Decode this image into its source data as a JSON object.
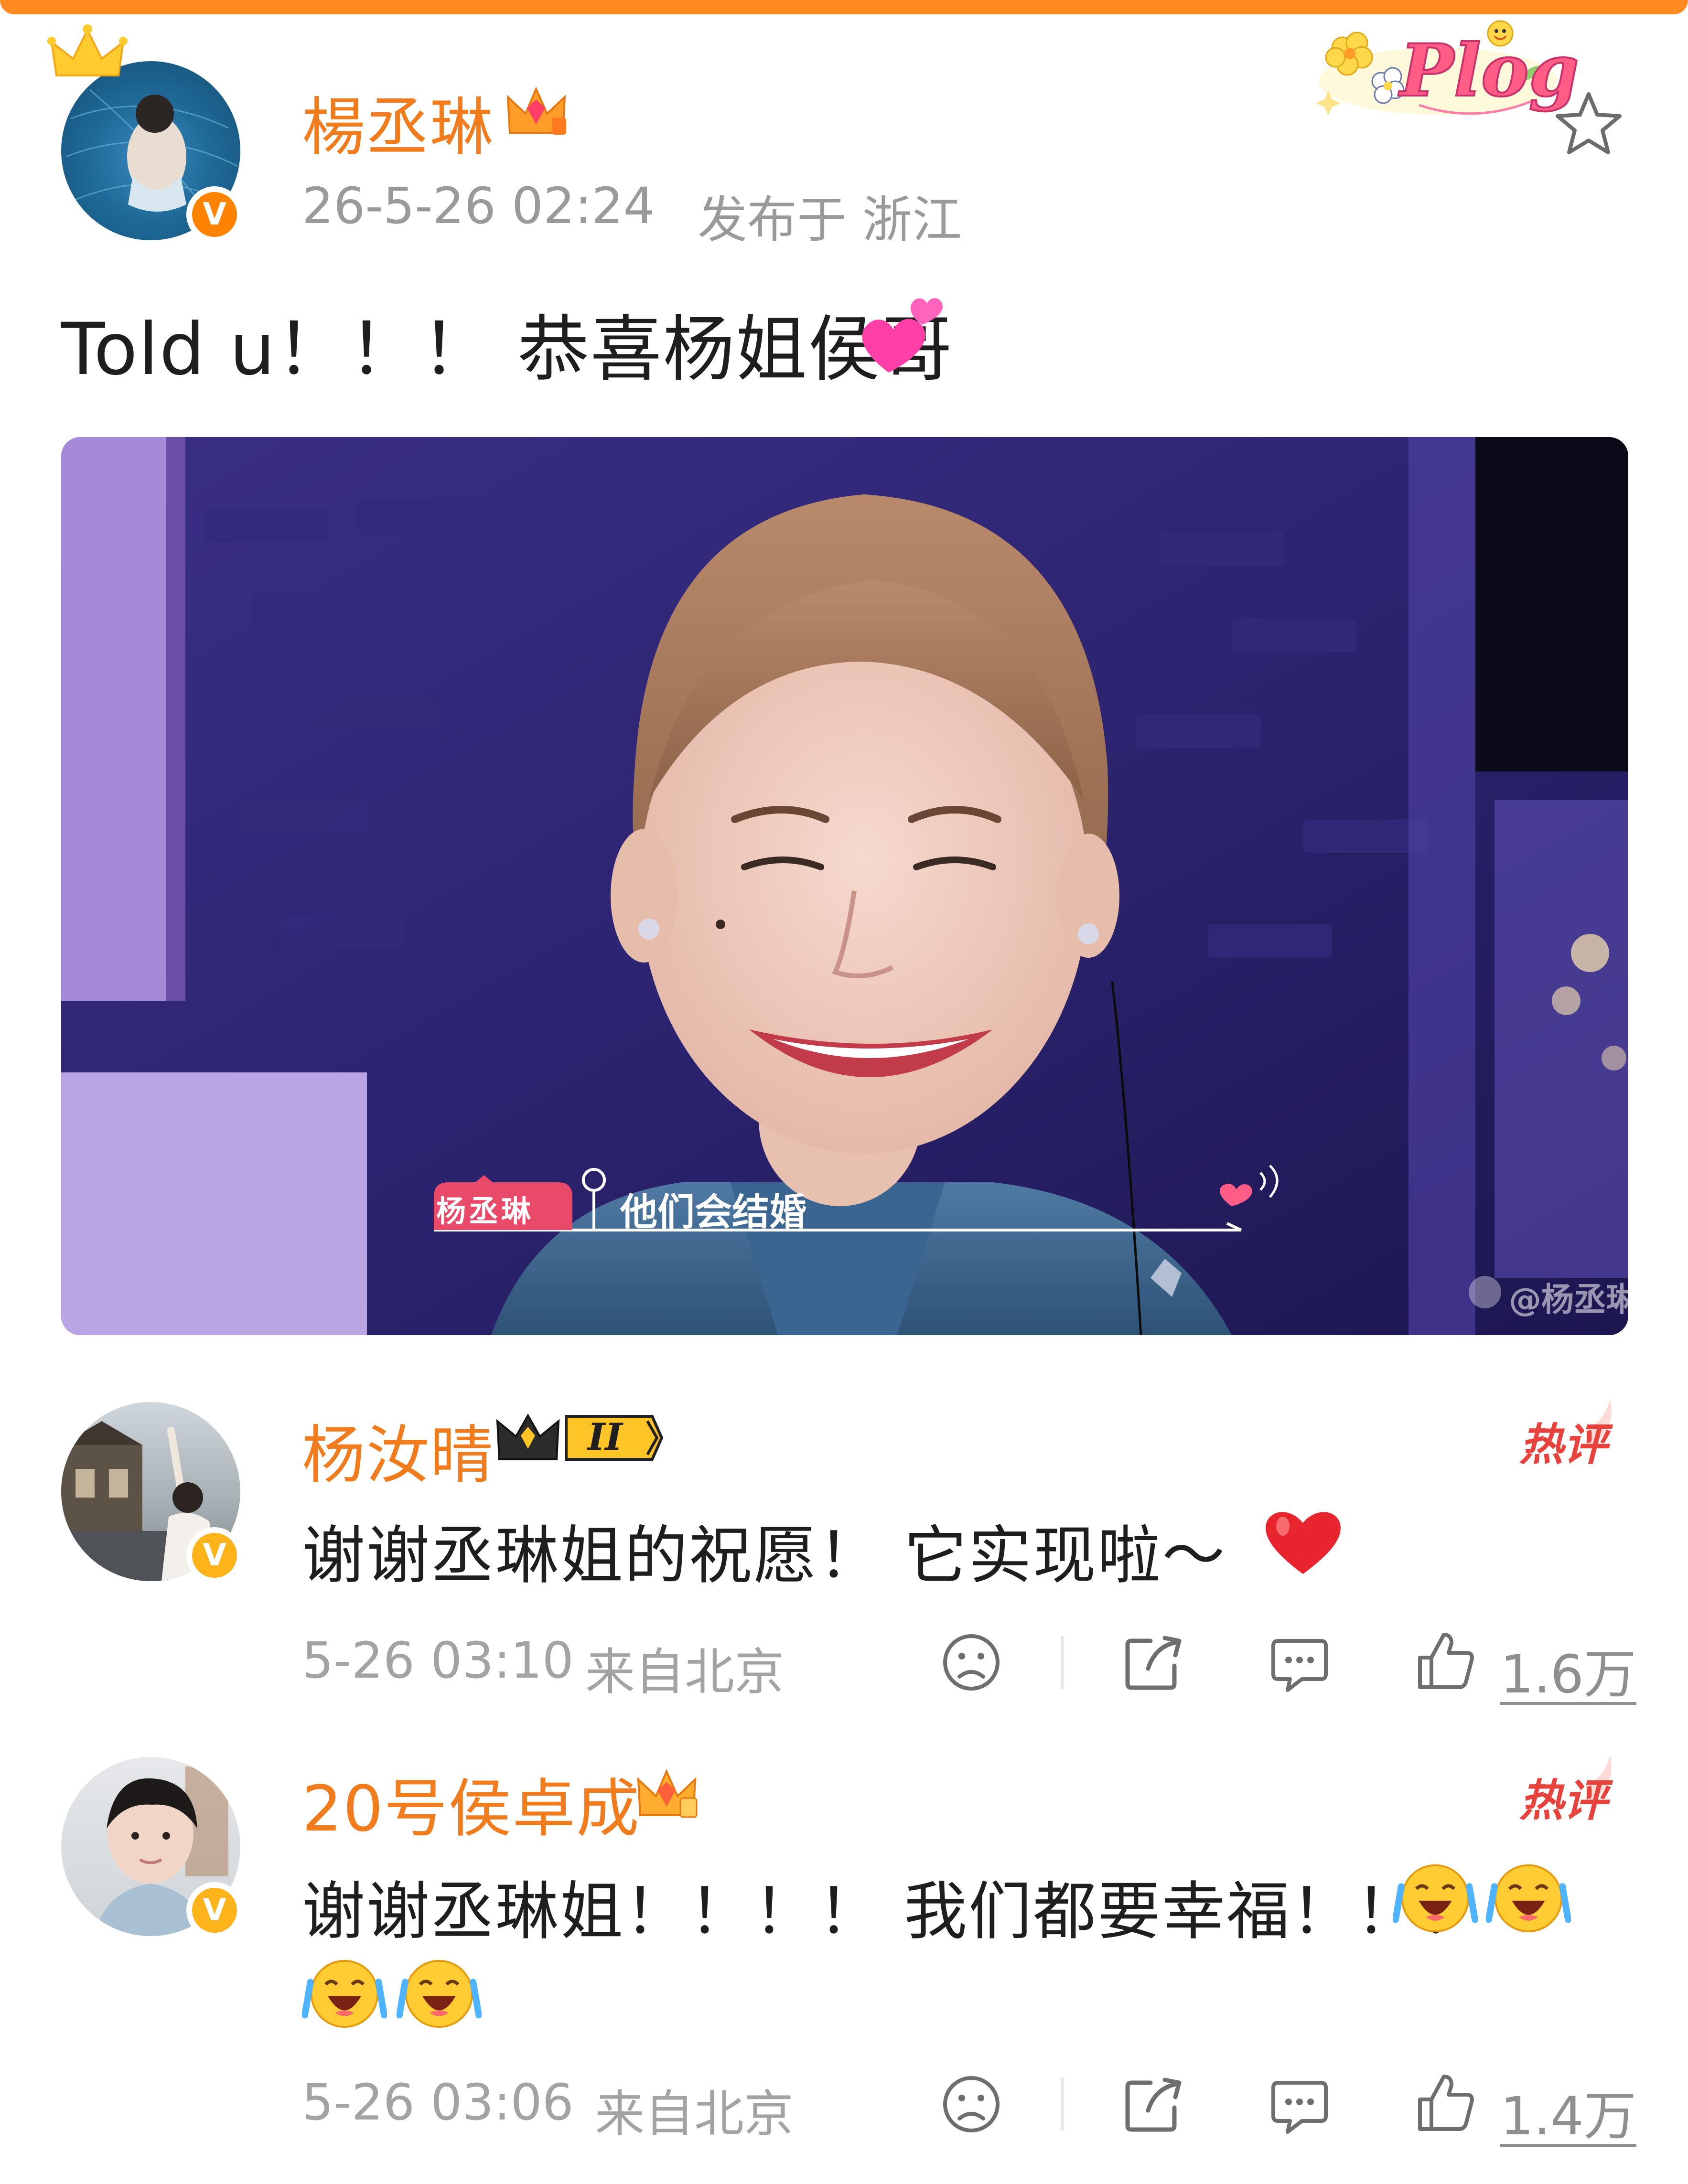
{
  "post": {
    "author": "楊丞琳",
    "time": "26-5-26 02:24",
    "location": "发布于 浙江",
    "text": "Told u！！！ 恭喜杨姐侯哥",
    "sticker": "Plog",
    "image": {
      "tag": "杨丞琳",
      "caption": "他们会结婚",
      "watermark": "@杨丞琳"
    }
  },
  "comments": [
    {
      "author": "杨汝晴",
      "level_badge": "II",
      "hot_label": "热评",
      "text": "谢谢丞琳姐的祝愿！ 它实现啦～",
      "time": "5-26 03:10",
      "location": "来自北京",
      "likes": "1.6万"
    },
    {
      "author": "20号侯卓成",
      "hot_label": "热评",
      "text": "谢谢丞琳姐！！！！ 我们都要幸福！！！",
      "time": "5-26 03:06",
      "location": "来自北京",
      "likes": "1.4万"
    }
  ],
  "icons": {
    "verified": "verified-v-icon",
    "crown": "crown-icon",
    "favorite": "star-icon",
    "dislike": "sad-face-icon",
    "share": "share-icon",
    "comment": "comment-icon",
    "like": "thumbs-up-icon"
  },
  "colors": {
    "accent_orange": "#f07c1e",
    "verified_orange": "#ff8200",
    "hot_red": "#e8423c",
    "meta_gray": "#9a9a9a"
  }
}
